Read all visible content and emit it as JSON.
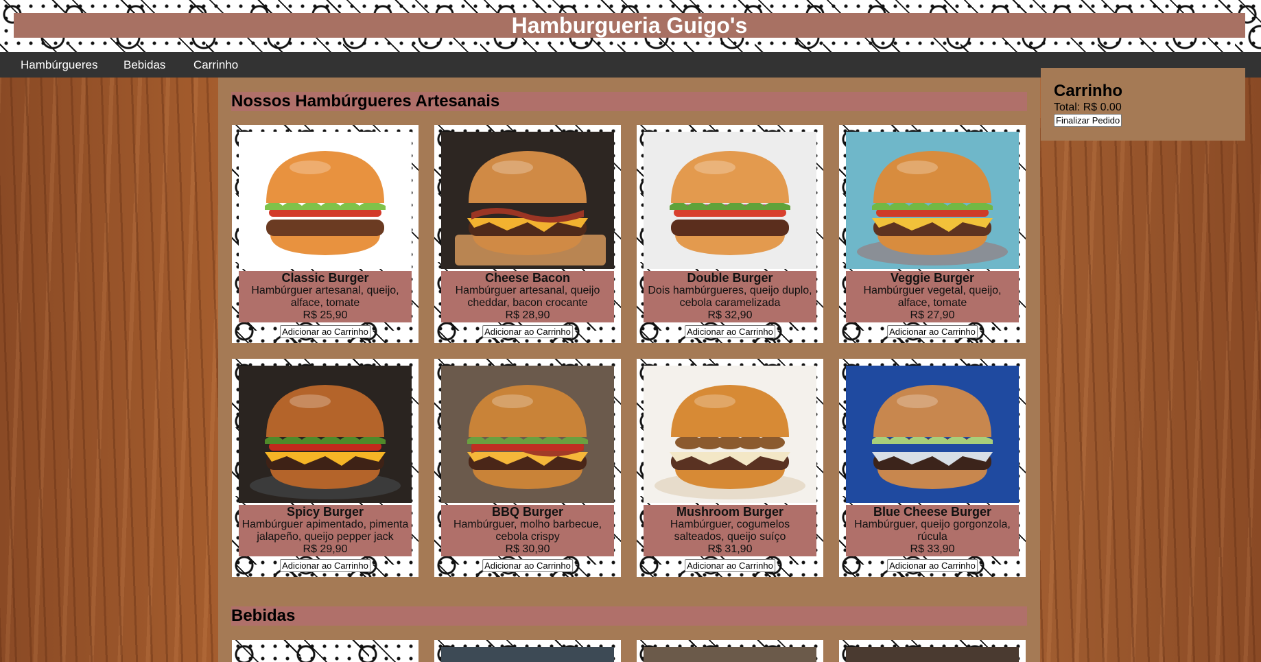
{
  "header": {
    "title": "Hamburgueria Guigo's"
  },
  "nav": {
    "items": [
      "Hambúrgueres",
      "Bebidas",
      "Carrinho"
    ]
  },
  "sections": {
    "burgers": {
      "title": "Nossos Hambúrgueres Artesanais"
    },
    "drinks": {
      "title": "Bebidas"
    }
  },
  "products": [
    {
      "name": "Classic Burger",
      "description": "Hambúrguer artesanal, queijo, alface, tomate",
      "price": "R$ 25,90",
      "button": "Adicionar ao Carrinho"
    },
    {
      "name": "Cheese Bacon",
      "description": "Hambúrguer artesanal, queijo cheddar, bacon crocante",
      "price": "R$ 28,90",
      "button": "Adicionar ao Carrinho"
    },
    {
      "name": "Double Burger",
      "description": "Dois hambúrgueres, queijo duplo, cebola caramelizada",
      "price": "R$ 32,90",
      "button": "Adicionar ao Carrinho"
    },
    {
      "name": "Veggie Burger",
      "description": "Hambúrguer vegetal, queijo, alface, tomate",
      "price": "R$ 27,90",
      "button": "Adicionar ao Carrinho"
    },
    {
      "name": "Spicy Burger",
      "description": "Hambúrguer apimentado, pimenta jalapeño, queijo pepper jack",
      "price": "R$ 29,90",
      "button": "Adicionar ao Carrinho"
    },
    {
      "name": "BBQ Burger",
      "description": "Hambúrguer, molho barbecue, cebola crispy",
      "price": "R$ 30,90",
      "button": "Adicionar ao Carrinho"
    },
    {
      "name": "Mushroom Burger",
      "description": "Hambúrguer, cogumelos salteados, queijo suíço",
      "price": "R$ 31,90",
      "button": "Adicionar ao Carrinho"
    },
    {
      "name": "Blue Cheese Burger",
      "description": "Hambúrguer, queijo gorgonzola, rúcula",
      "price": "R$ 33,90",
      "button": "Adicionar ao Carrinho"
    }
  ],
  "cart": {
    "title": "Carrinho",
    "total": "Total: R$ 0.00",
    "checkout": "Finalizar Pedido"
  },
  "colors": {
    "accent": "#b0706a",
    "panel": "#a57a55",
    "nav": "#333333",
    "title_bar": "#a87163"
  }
}
